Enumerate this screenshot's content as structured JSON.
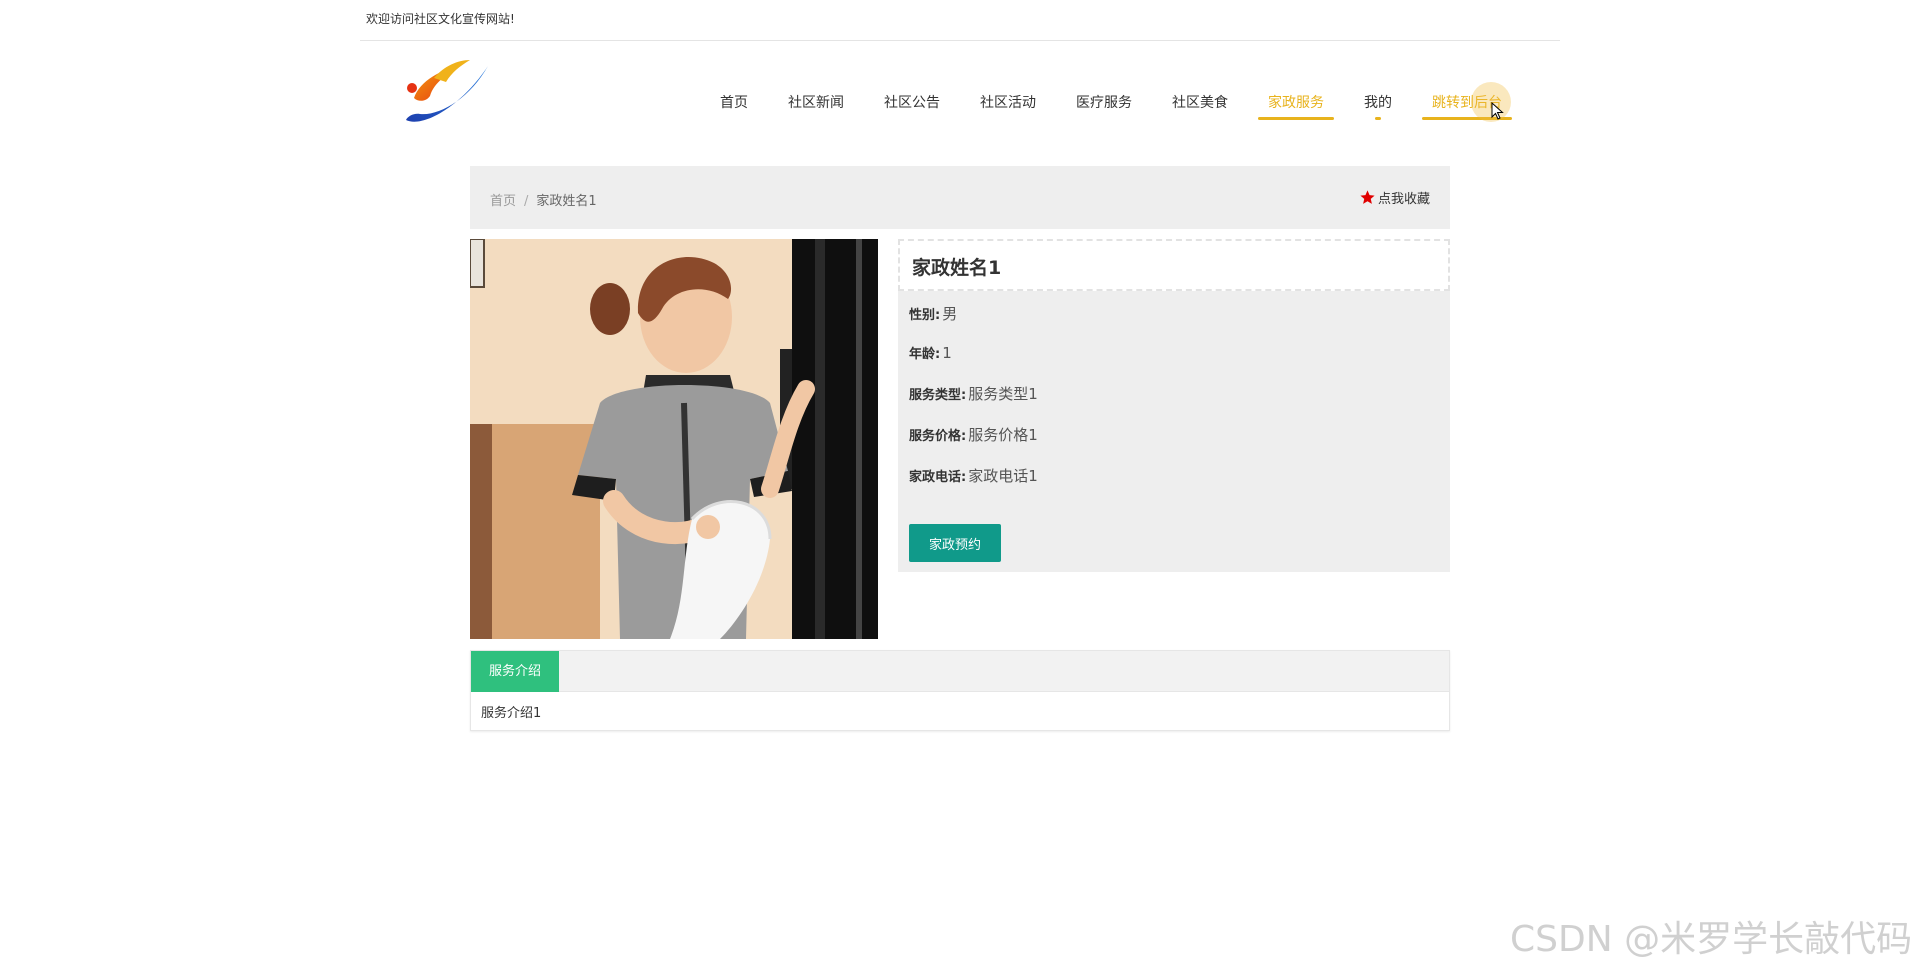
{
  "topbar": {
    "welcome": "欢迎访问社区文化宣传网站!"
  },
  "nav": {
    "items": [
      {
        "label": "首页"
      },
      {
        "label": "社区新闻"
      },
      {
        "label": "社区公告"
      },
      {
        "label": "社区活动"
      },
      {
        "label": "医疗服务"
      },
      {
        "label": "社区美食"
      },
      {
        "label": "家政服务"
      },
      {
        "label": "我的"
      },
      {
        "label": "跳转到后台"
      }
    ],
    "active_index": 6,
    "accent_color": "#e8b31d"
  },
  "breadcrumb": {
    "home": "首页",
    "separator": "/",
    "current": "家政姓名1"
  },
  "favorite": {
    "label": "点我收藏",
    "icon": "star-icon",
    "color": "#e00000"
  },
  "detail": {
    "title": "家政姓名1",
    "fields": [
      {
        "label": "性别:",
        "value": "男"
      },
      {
        "label": "年龄:",
        "value": "1"
      },
      {
        "label": "服务类型:",
        "value": "服务类型1"
      },
      {
        "label": "服务价格:",
        "value": "服务价格1"
      },
      {
        "label": "家政电话:",
        "value": "家政电话1"
      }
    ],
    "book_button": "家政预约",
    "button_color": "#109a8a"
  },
  "tabs": {
    "items": [
      {
        "label": "服务介绍"
      }
    ],
    "content": "服务介绍1",
    "active_color": "#2fc07e"
  },
  "watermark": "CSDN @米罗学长敲代码"
}
